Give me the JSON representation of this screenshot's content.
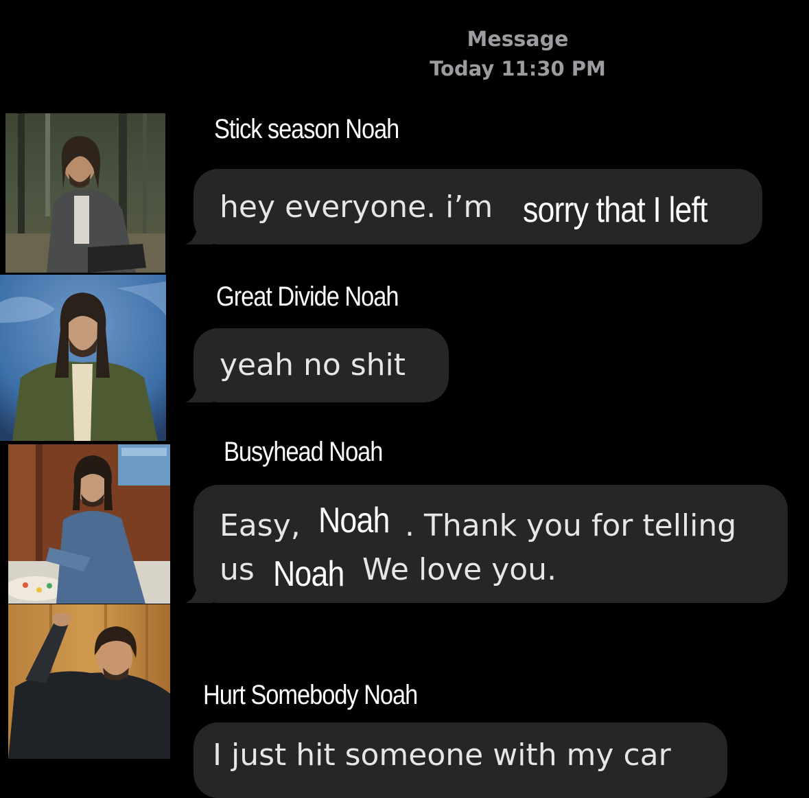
{
  "header": {
    "title": "Message",
    "timestamp": "Today 11:30 PM"
  },
  "thread": [
    {
      "sender": "Stick season Noah",
      "avatar_icon": "person-photo-icon",
      "message_parts": [
        "hey everyone. i’m",
        "sorry that I left"
      ]
    },
    {
      "sender": "Great Divide Noah",
      "avatar_icon": "person-photo-icon",
      "message_parts": [
        "yeah no shit"
      ]
    },
    {
      "sender": "Busyhead Noah",
      "avatar_icon": "person-photo-icon",
      "message_parts": [
        "Easy,",
        "Noah",
        ". Thank you for telling",
        "us",
        "Noah",
        "We love you."
      ]
    },
    {
      "sender": "Hurt Somebody Noah",
      "avatar_icon": "person-photo-icon",
      "message_parts": [
        "I just hit someone with my car"
      ]
    }
  ],
  "colors": {
    "background": "#000000",
    "bubble": "#262628",
    "bubble_text": "#e6e6e8",
    "header_text": "#9c9ca1",
    "name_text": "#ffffff"
  }
}
